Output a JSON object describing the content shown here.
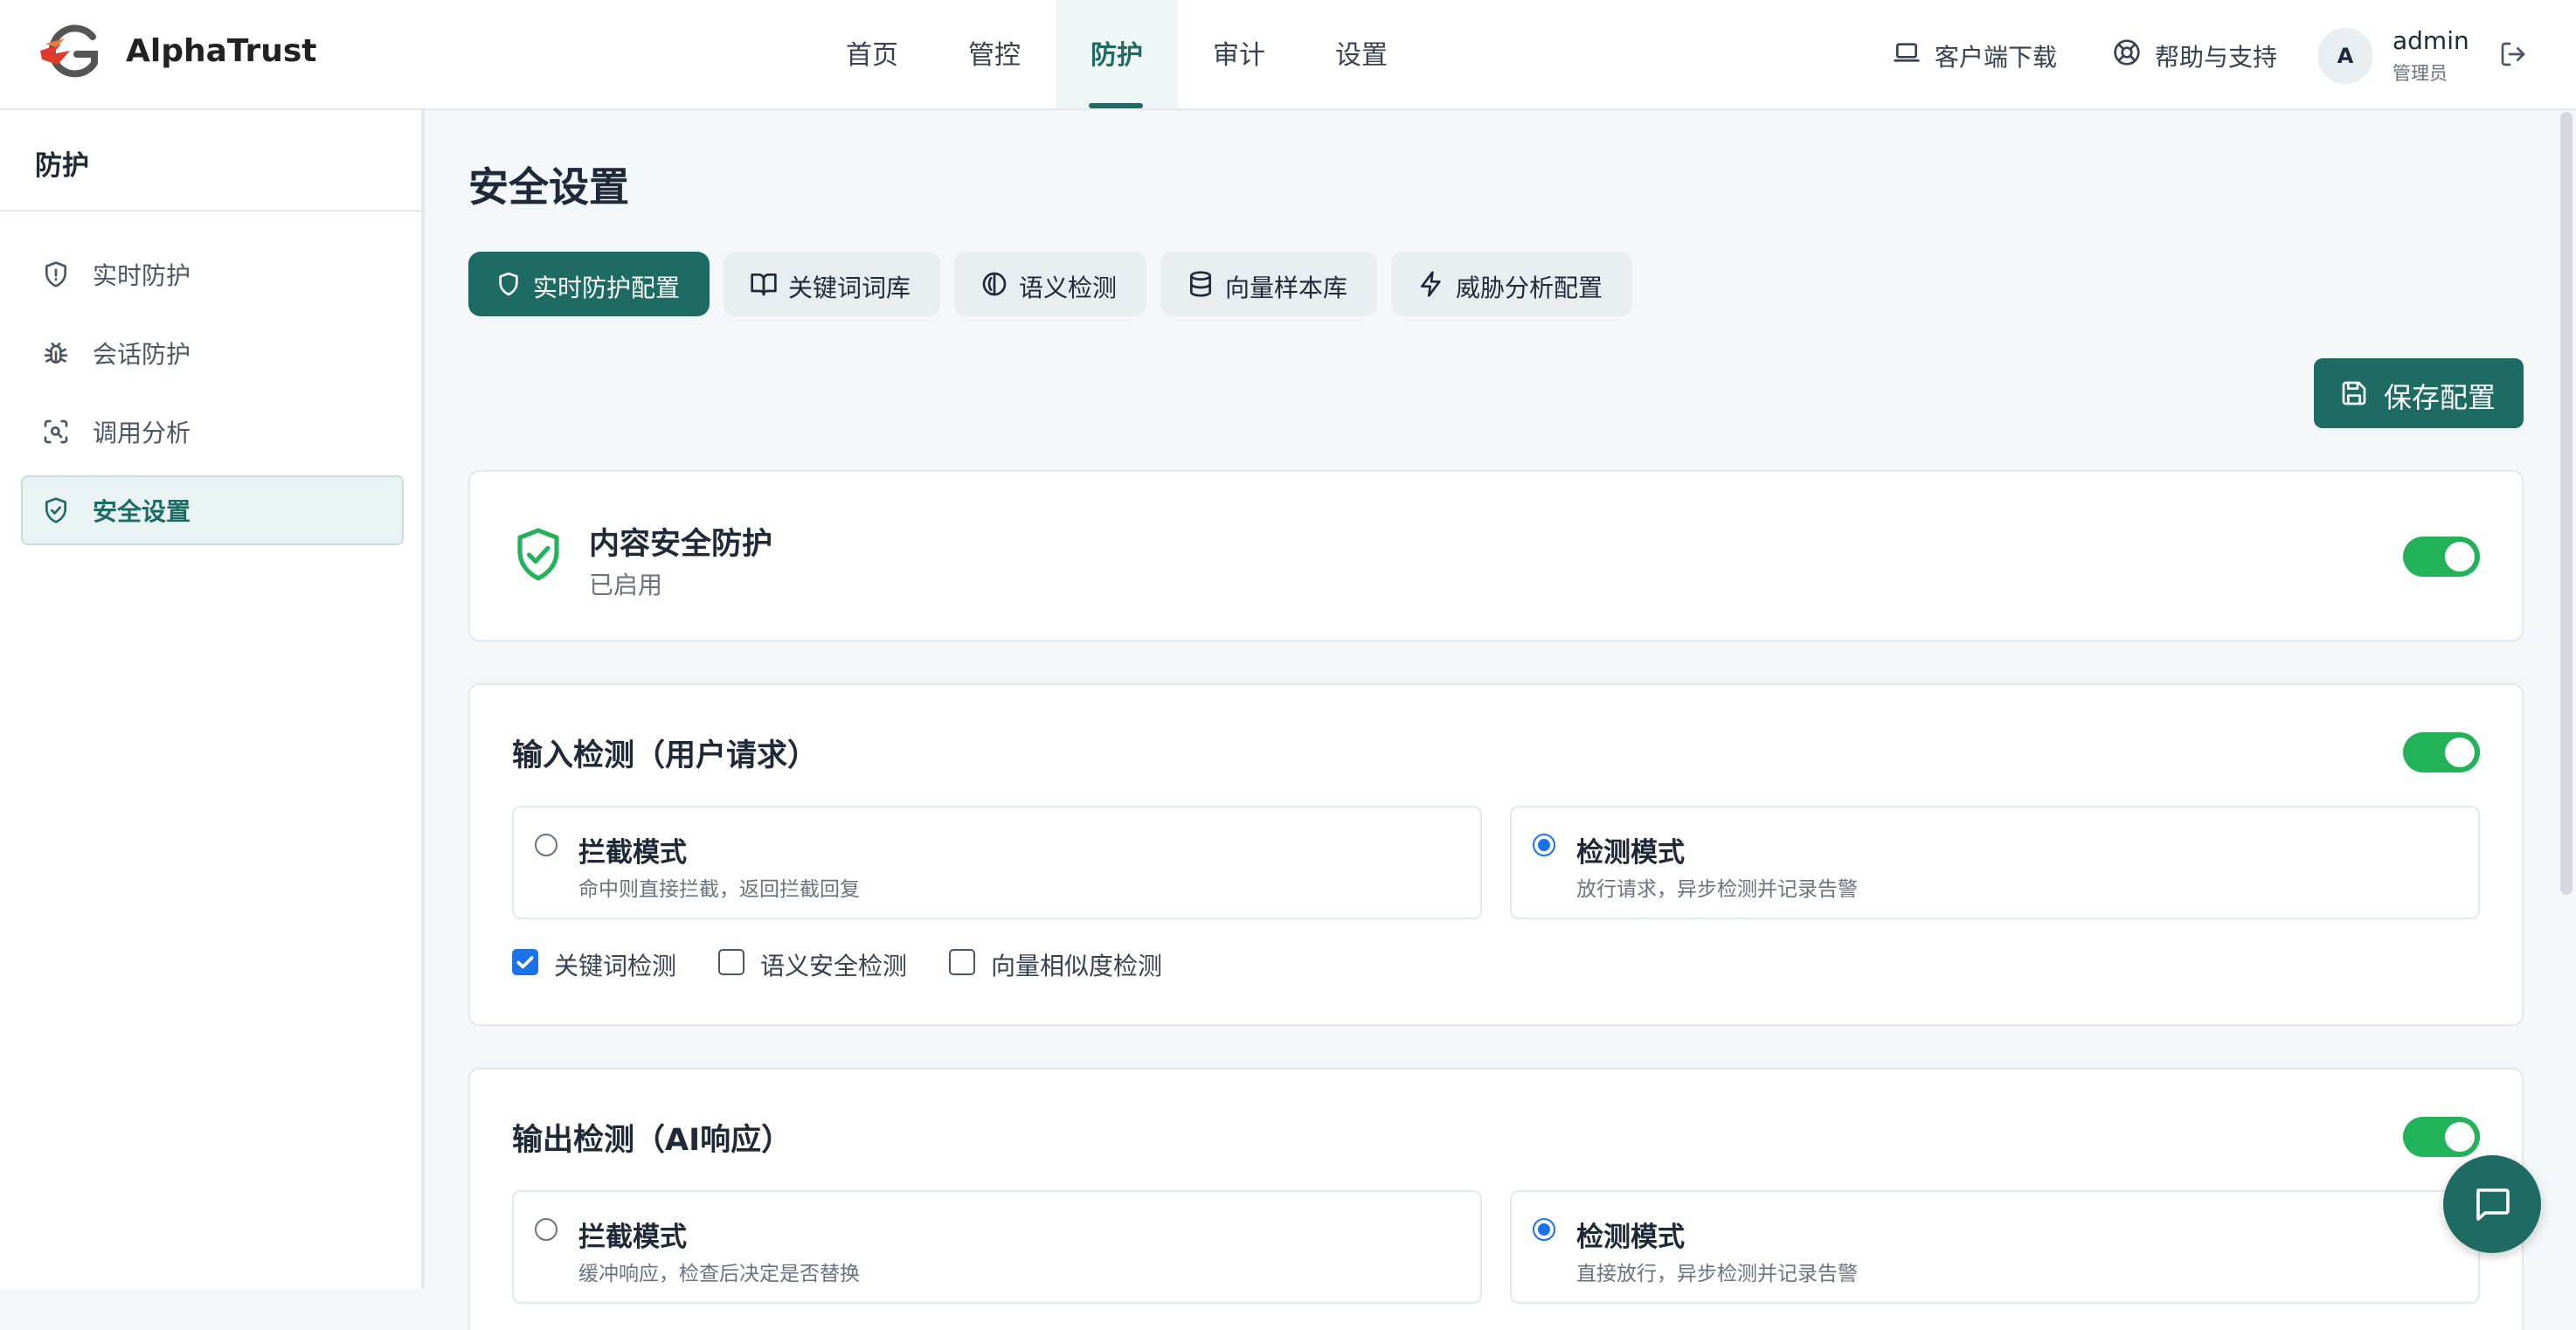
{
  "app": {
    "brand": "AlphaTrust"
  },
  "nav": {
    "items": [
      {
        "label": "首页"
      },
      {
        "label": "管控"
      },
      {
        "label": "防护",
        "active": true
      },
      {
        "label": "审计"
      },
      {
        "label": "设置"
      }
    ]
  },
  "header": {
    "download_label": "客户端下载",
    "help_label": "帮助与支持",
    "avatar_initial": "A",
    "user_name": "admin",
    "user_role": "管理员"
  },
  "sidebar": {
    "title": "防护",
    "items": [
      {
        "label": "实时防护",
        "icon": "shield-icon"
      },
      {
        "label": "会话防护",
        "icon": "bug-icon"
      },
      {
        "label": "调用分析",
        "icon": "scan-search-icon"
      },
      {
        "label": "安全设置",
        "icon": "shield-check-icon",
        "active": true
      }
    ]
  },
  "main": {
    "title": "安全设置",
    "tabs": [
      {
        "label": "实时防护配置",
        "icon": "shield-icon",
        "active": true
      },
      {
        "label": "关键词词库",
        "icon": "book-icon"
      },
      {
        "label": "语义检测",
        "icon": "semantic-icon"
      },
      {
        "label": "向量样本库",
        "icon": "database-icon"
      },
      {
        "label": "威胁分析配置",
        "icon": "zap-icon"
      }
    ],
    "save_label": "保存配置",
    "content_protection": {
      "title": "内容安全防护",
      "status": "已启用",
      "enabled": true
    },
    "input_detection": {
      "title": "输入检测（用户请求）",
      "enabled": true,
      "modes": [
        {
          "title": "拦截模式",
          "desc": "命中则直接拦截，返回拦截回复",
          "selected": false
        },
        {
          "title": "检测模式",
          "desc": "放行请求，异步检测并记录告警",
          "selected": true
        }
      ],
      "checks": [
        {
          "label": "关键词检测",
          "checked": true
        },
        {
          "label": "语义安全检测",
          "checked": false
        },
        {
          "label": "向量相似度检测",
          "checked": false
        }
      ]
    },
    "output_detection": {
      "title": "输出检测（AI响应）",
      "enabled": true,
      "modes": [
        {
          "title": "拦截模式",
          "desc": "缓冲响应，检查后决定是否替换",
          "selected": false
        },
        {
          "title": "检测模式",
          "desc": "直接放行，异步检测并记录告警",
          "selected": true
        }
      ]
    }
  },
  "colors": {
    "primary": "#1e6b64",
    "toggle_on": "#22b35a",
    "radio_checked": "#1a73e8"
  }
}
